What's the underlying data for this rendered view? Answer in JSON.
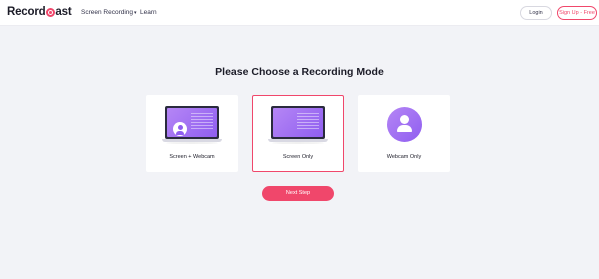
{
  "header": {
    "logo_text_before": "Record",
    "logo_text_after": "ast",
    "nav": {
      "screen_recording": "Screen Recording",
      "learn": "Learn"
    },
    "login_label": "Login",
    "signup_label": "Sign Up - Free"
  },
  "main": {
    "heading": "Please Choose a Recording Mode",
    "modes": [
      {
        "label": "Screen + Webcam",
        "icon": "laptop-with-avatar-icon",
        "selected": false
      },
      {
        "label": "Screen Only",
        "icon": "laptop-icon",
        "selected": true
      },
      {
        "label": "Webcam Only",
        "icon": "user-circle-icon",
        "selected": false
      }
    ],
    "next_label": "Next Step"
  },
  "colors": {
    "accent": "#f0476b",
    "purple": "#8f5ef0",
    "background": "#f2f3f7"
  }
}
